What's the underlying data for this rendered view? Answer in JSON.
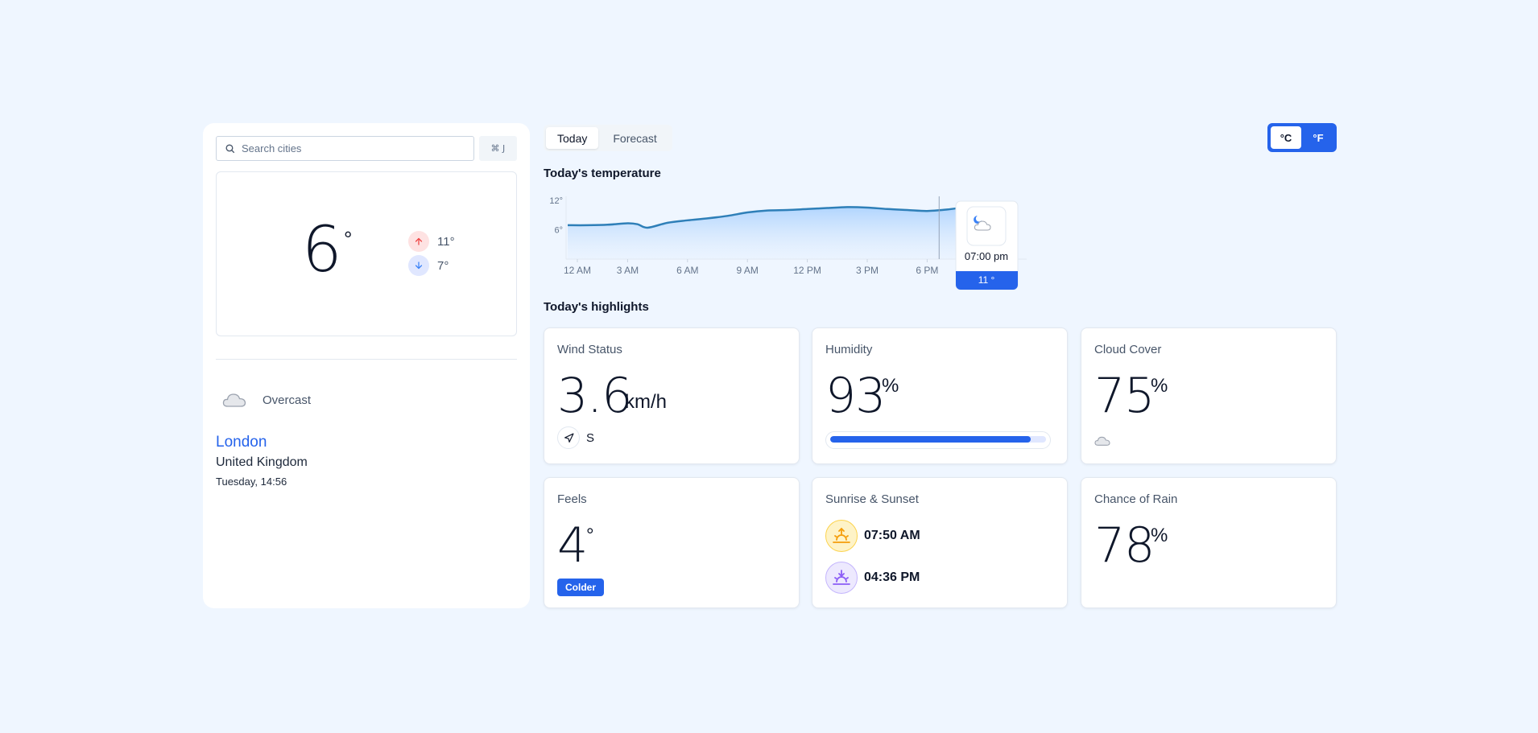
{
  "search": {
    "placeholder": "Search cities",
    "shortcut": "⌘ J"
  },
  "current": {
    "temp": "6",
    "deg": "°",
    "high": "11°",
    "low": "7°",
    "condition": "Overcast",
    "city": "London",
    "country": "United Kingdom",
    "datetime": "Tuesday, 14:56"
  },
  "tabs": [
    {
      "label": "Today",
      "active": true
    },
    {
      "label": "Forecast",
      "active": false
    }
  ],
  "units": [
    {
      "label": "°C",
      "active": true
    },
    {
      "label": "°F",
      "active": false
    }
  ],
  "titles": {
    "temperature": "Today's temperature",
    "highlights": "Today's highlights"
  },
  "chart_data": {
    "type": "area",
    "title": "Today's temperature",
    "x_ticks": [
      "12 AM",
      "3 AM",
      "6 AM",
      "9 AM",
      "12 PM",
      "3 PM",
      "6 PM"
    ],
    "y_ticks": [
      "12°",
      "6°"
    ],
    "ylim": [
      0,
      12
    ],
    "x": [
      0,
      1,
      2,
      3,
      3.5,
      4,
      5,
      6,
      7,
      8,
      9,
      10,
      11,
      12,
      13,
      14,
      15,
      16,
      17,
      18,
      19,
      20,
      21
    ],
    "values": [
      6.9,
      6.9,
      7.0,
      7.3,
      7.1,
      6.4,
      7.4,
      7.9,
      8.3,
      8.8,
      9.5,
      9.9,
      10.0,
      10.2,
      10.4,
      10.6,
      10.5,
      10.2,
      10.0,
      9.8,
      10.1,
      10.6,
      10.8
    ],
    "tooltip": {
      "time": "07:00 pm",
      "value": "11 °"
    },
    "colors": {
      "line": "#2e7fb8",
      "fill": "#bfdbfe",
      "tooltip": "#2563eb"
    }
  },
  "highlights": {
    "wind": {
      "title": "Wind Status",
      "value": "3.6",
      "unit": "km/h",
      "direction": "S"
    },
    "humidity": {
      "title": "Humidity",
      "value": "93",
      "unit": "%",
      "progress": 0.93
    },
    "cloud": {
      "title": "Cloud Cover",
      "value": "75",
      "unit": "%"
    },
    "feels": {
      "title": "Feels",
      "value": "4",
      "unit": "°",
      "badge": "Colder"
    },
    "sun": {
      "title": "Sunrise & Sunset",
      "sunrise": "07:50 AM",
      "sunset": "04:36 PM"
    },
    "rain": {
      "title": "Chance of Rain",
      "value": "78",
      "unit": "%"
    }
  },
  "icons": {
    "search": "search-icon",
    "up": "arrow-up-icon",
    "down": "arrow-down-icon",
    "cloud": "cloud-icon",
    "navigation": "navigation-icon",
    "sunrise": "sunrise-icon",
    "sunset": "sunset-icon",
    "night_cloud": "moon-cloud-icon"
  }
}
